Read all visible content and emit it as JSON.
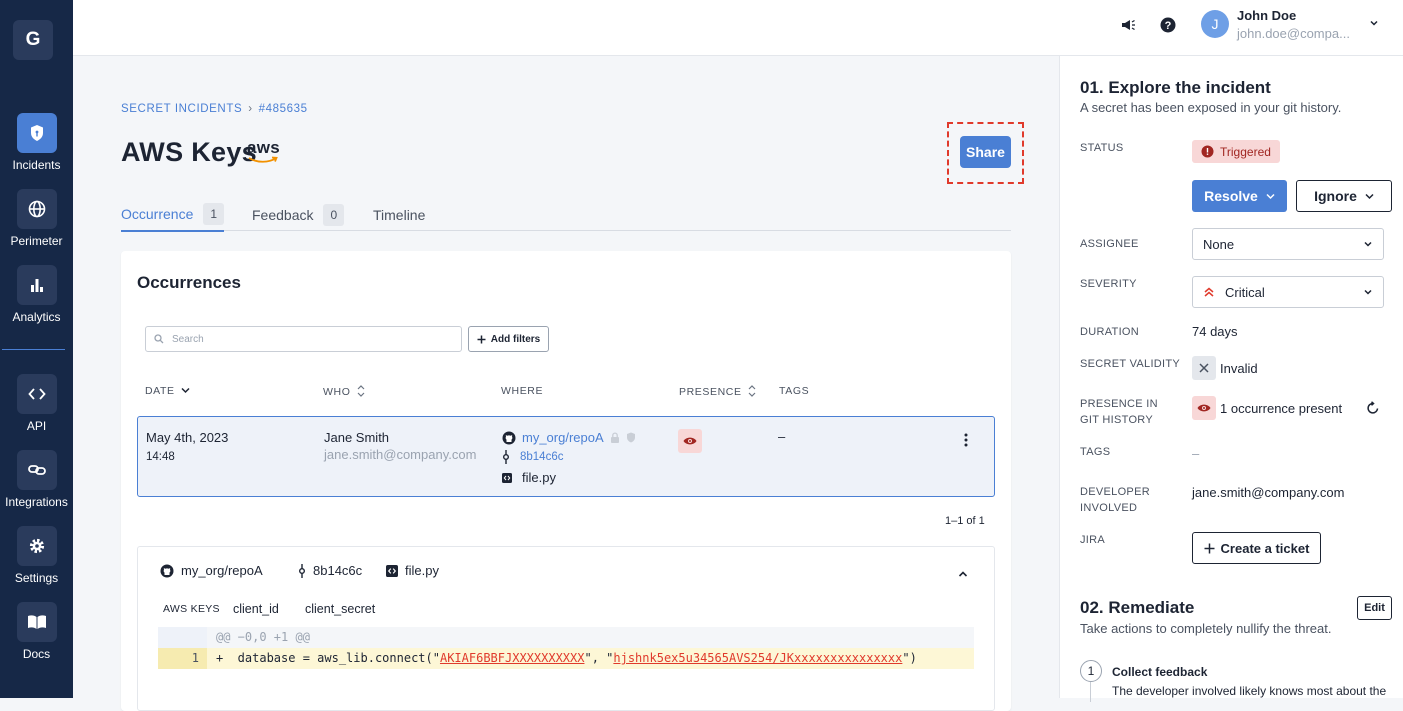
{
  "sidebar": {
    "logo": "G",
    "items": [
      {
        "label": "Incidents",
        "icon": "shield-icon"
      },
      {
        "label": "Perimeter",
        "icon": "globe-icon"
      },
      {
        "label": "Analytics",
        "icon": "bar-chart-icon"
      },
      {
        "label": "API",
        "icon": "code-icon"
      },
      {
        "label": "Integrations",
        "icon": "plug-icon"
      },
      {
        "label": "Settings",
        "icon": "gear-icon"
      },
      {
        "label": "Docs",
        "icon": "book-icon"
      }
    ]
  },
  "topbar": {
    "user_initial": "J",
    "user_name": "John Doe",
    "user_email": "john.doe@compa..."
  },
  "breadcrumb": {
    "section": "SECRET INCIDENTS",
    "separator": "›",
    "id": "#485635"
  },
  "incident": {
    "title": "AWS Keys",
    "provider_logo": "aws"
  },
  "share_label": "Share",
  "tabs": [
    {
      "label": "Occurrence",
      "count": "1"
    },
    {
      "label": "Feedback",
      "count": "0"
    },
    {
      "label": "Timeline"
    }
  ],
  "occurrences": {
    "title": "Occurrences",
    "search_placeholder": "Search",
    "add_filters": "Add filters",
    "columns": [
      "DATE",
      "WHO",
      "WHERE",
      "PRESENCE",
      "TAGS"
    ],
    "rows": [
      {
        "date": "May 4th, 2023",
        "time": "14:48",
        "who_name": "Jane Smith",
        "who_email": "jane.smith@company.com",
        "repo": "my_org/repoA",
        "commit": "8b14c6c",
        "file": "file.py",
        "tags": "–"
      }
    ],
    "pagination": "1–1 of 1"
  },
  "detail": {
    "repo": "my_org/repoA",
    "commit": "8b14c6c",
    "file": "file.py",
    "key_tabs": [
      "AWS KEYS",
      "client_id",
      "client_secret"
    ],
    "diff_header": "@@ −0,0 +1 @@",
    "line_no": "1",
    "code_prefix": "+  database = aws_lib.connect(\"",
    "secret1": "AKIAF6BBFJXXXXXXXXXX",
    "code_mid": "\", \"",
    "secret2": "hjshnk5ex5u34565AVS254/JKxxxxxxxxxxxxxxx",
    "code_suffix": "\")"
  },
  "panel": {
    "explore_title": "01. Explore the incident",
    "explore_sub": "A secret has been exposed in your git history.",
    "status_label": "STATUS",
    "status_value": "Triggered",
    "resolve": "Resolve",
    "ignore": "Ignore",
    "assignee_label": "ASSIGNEE",
    "assignee_value": "None",
    "severity_label": "SEVERITY",
    "severity_value": "Critical",
    "duration_label": "DURATION",
    "duration_value": "74 days",
    "validity_label": "SECRET VALIDITY",
    "validity_value": "Invalid",
    "presence_label": "PRESENCE IN GIT HISTORY",
    "presence_value": "1 occurrence present",
    "tags_label": "TAGS",
    "tags_value": "–",
    "developer_label": "DEVELOPER INVOLVED",
    "developer_value": "jane.smith@company.com",
    "jira_label": "JIRA",
    "create_ticket": "Create a ticket",
    "remediate_title": "02. Remediate",
    "remediate_sub": "Take actions to completely nullify the threat.",
    "edit": "Edit",
    "step_no": "1",
    "step_title": "Collect feedback",
    "step_text": "The developer involved likely knows most about the"
  },
  "colors": {
    "accent": "#4a7fd4",
    "sidebar": "#162847",
    "danger": "#e03a2c"
  }
}
